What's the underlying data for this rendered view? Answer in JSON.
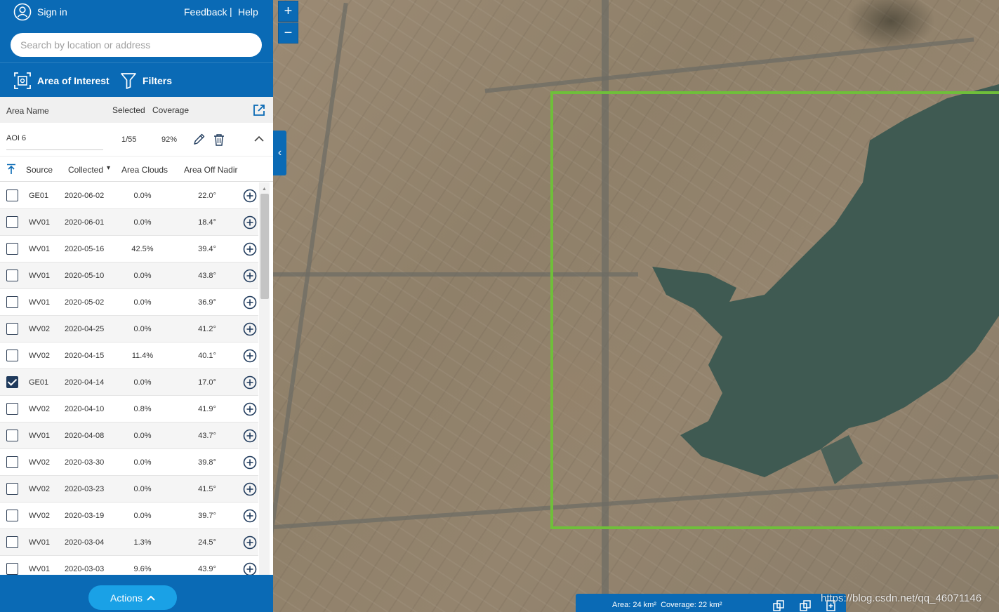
{
  "header": {
    "sign_in": "Sign in",
    "feedback": "Feedback",
    "separator": "|",
    "help": "Help"
  },
  "search": {
    "placeholder": "Search by location or address",
    "value": ""
  },
  "tabs": {
    "area_of_interest": "Area of Interest",
    "filters": "Filters"
  },
  "area_table": {
    "col_name": "Area Name",
    "col_selected": "Selected",
    "col_coverage": "Coverage"
  },
  "aoi": {
    "name": "AOI 6",
    "selected": "1/55",
    "coverage": "92%"
  },
  "columns": {
    "source": "Source",
    "collected": "Collected",
    "sort_caret": "▾",
    "clouds": "Area Clouds",
    "nadir": "Area Off Nadir"
  },
  "images": [
    {
      "source": "GE01",
      "date": "2020-06-02",
      "clouds": "0.0%",
      "nadir": "22.0°",
      "checked": false
    },
    {
      "source": "WV01",
      "date": "2020-06-01",
      "clouds": "0.0%",
      "nadir": "18.4°",
      "checked": false
    },
    {
      "source": "WV01",
      "date": "2020-05-16",
      "clouds": "42.5%",
      "nadir": "39.4°",
      "checked": false
    },
    {
      "source": "WV01",
      "date": "2020-05-10",
      "clouds": "0.0%",
      "nadir": "43.8°",
      "checked": false
    },
    {
      "source": "WV01",
      "date": "2020-05-02",
      "clouds": "0.0%",
      "nadir": "36.9°",
      "checked": false
    },
    {
      "source": "WV02",
      "date": "2020-04-25",
      "clouds": "0.0%",
      "nadir": "41.2°",
      "checked": false
    },
    {
      "source": "WV02",
      "date": "2020-04-15",
      "clouds": "11.4%",
      "nadir": "40.1°",
      "checked": false
    },
    {
      "source": "GE01",
      "date": "2020-04-14",
      "clouds": "0.0%",
      "nadir": "17.0°",
      "checked": true
    },
    {
      "source": "WV02",
      "date": "2020-04-10",
      "clouds": "0.8%",
      "nadir": "41.9°",
      "checked": false
    },
    {
      "source": "WV01",
      "date": "2020-04-08",
      "clouds": "0.0%",
      "nadir": "43.7°",
      "checked": false
    },
    {
      "source": "WV02",
      "date": "2020-03-30",
      "clouds": "0.0%",
      "nadir": "39.8°",
      "checked": false
    },
    {
      "source": "WV02",
      "date": "2020-03-23",
      "clouds": "0.0%",
      "nadir": "41.5°",
      "checked": false
    },
    {
      "source": "WV02",
      "date": "2020-03-19",
      "clouds": "0.0%",
      "nadir": "39.7°",
      "checked": false
    },
    {
      "source": "WV01",
      "date": "2020-03-04",
      "clouds": "1.3%",
      "nadir": "24.5°",
      "checked": false
    },
    {
      "source": "WV01",
      "date": "2020-03-03",
      "clouds": "9.6%",
      "nadir": "43.9°",
      "checked": false
    }
  ],
  "footer": {
    "actions": "Actions"
  },
  "map": {
    "zoom_in": "+",
    "zoom_out": "−",
    "collapse": "‹",
    "summary_area": "Area: 24 km²",
    "summary_coverage": "Coverage: 22 km²",
    "aoi_color": "#6fbf3a"
  },
  "watermark": "https://blog.csdn.net/qq_46071146",
  "colors": {
    "primary": "#0a6ab5",
    "accent": "#1aa1e6",
    "checkbox": "#1f3a5c"
  }
}
